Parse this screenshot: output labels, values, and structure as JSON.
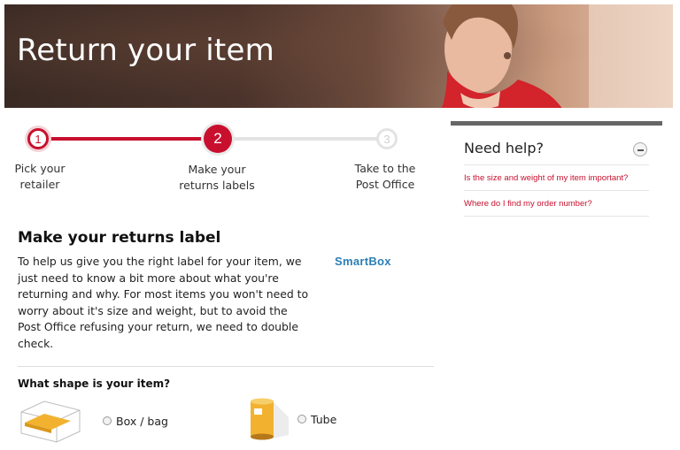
{
  "hero": {
    "title": "Return your item"
  },
  "progress": {
    "steps": [
      {
        "number": "1",
        "label_line1": "Pick your",
        "label_line2": "retailer",
        "state": "done"
      },
      {
        "number": "2",
        "label_line1": "Make your",
        "label_line2": "returns labels",
        "state": "current"
      },
      {
        "number": "3",
        "label_line1": "Take to the",
        "label_line2": "Post Office",
        "state": "todo"
      }
    ]
  },
  "main": {
    "title": "Make your returns label",
    "intro": "To help us give you the right label for your item, we just need to know a bit more about what you're returning and why. For most items you won't need to worry about it's size and weight, but to avoid the Post Office refusing your return, we need to double check.",
    "retailer_logo_text": "SmartBox",
    "question": "What shape is your item?",
    "options": [
      {
        "label": "Box / bag",
        "icon": "box-bag-icon"
      },
      {
        "label": "Tube",
        "icon": "tube-icon"
      }
    ]
  },
  "help": {
    "title": "Need help?",
    "links": [
      "Is the size and weight of my item important?",
      "Where do I find my order number?"
    ]
  },
  "colors": {
    "brand_red": "#c8102e",
    "logo_blue": "#2a7fb5",
    "panel_bar": "#666666"
  }
}
